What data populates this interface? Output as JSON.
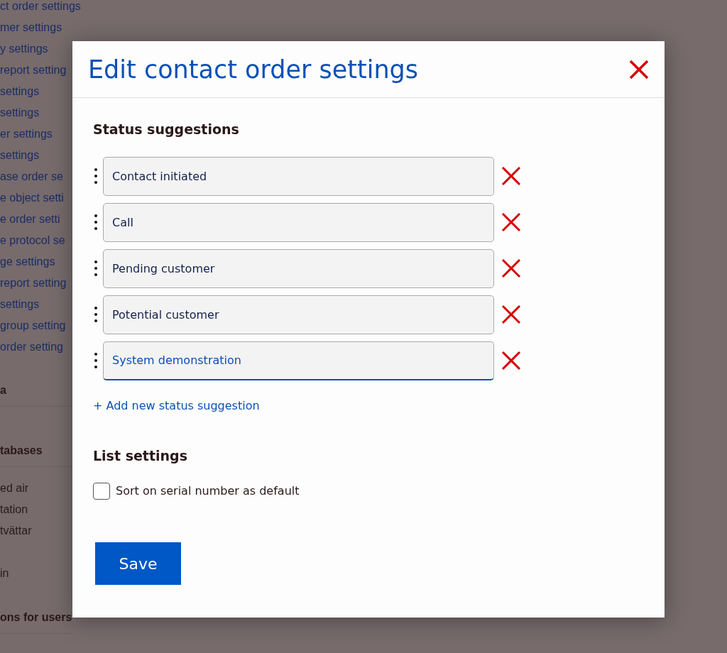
{
  "background": {
    "links": [
      "ct order settings",
      "mer settings",
      "y settings",
      "report setting",
      "settings",
      "settings",
      "er settings",
      "settings",
      "ase order se",
      "e object setti",
      "e order setti",
      "e protocol se",
      "ge settings",
      "report setting",
      "settings",
      "group setting",
      "order setting"
    ],
    "sections": [
      {
        "heading": "a"
      },
      {
        "heading": "tabases",
        "items": [
          {
            "text": "ed air"
          },
          {
            "text": "tation"
          },
          {
            "text": "tvättar"
          },
          {
            "text": "in",
            "gap_before": true
          }
        ]
      },
      {
        "heading": "ons for users"
      }
    ]
  },
  "modal": {
    "title": "Edit contact order settings",
    "status_heading": "Status suggestions",
    "suggestions": [
      {
        "value": "Contact initiated",
        "focused": false
      },
      {
        "value": "Call",
        "focused": false
      },
      {
        "value": "Pending customer",
        "focused": false
      },
      {
        "value": "Potential customer",
        "focused": false
      },
      {
        "value": "System demonstration",
        "focused": true
      }
    ],
    "add_link": "+ Add new status suggestion",
    "list_heading": "List settings",
    "sort_option": {
      "label": "Sort on serial number as default",
      "checked": false
    },
    "save_button": "Save"
  }
}
